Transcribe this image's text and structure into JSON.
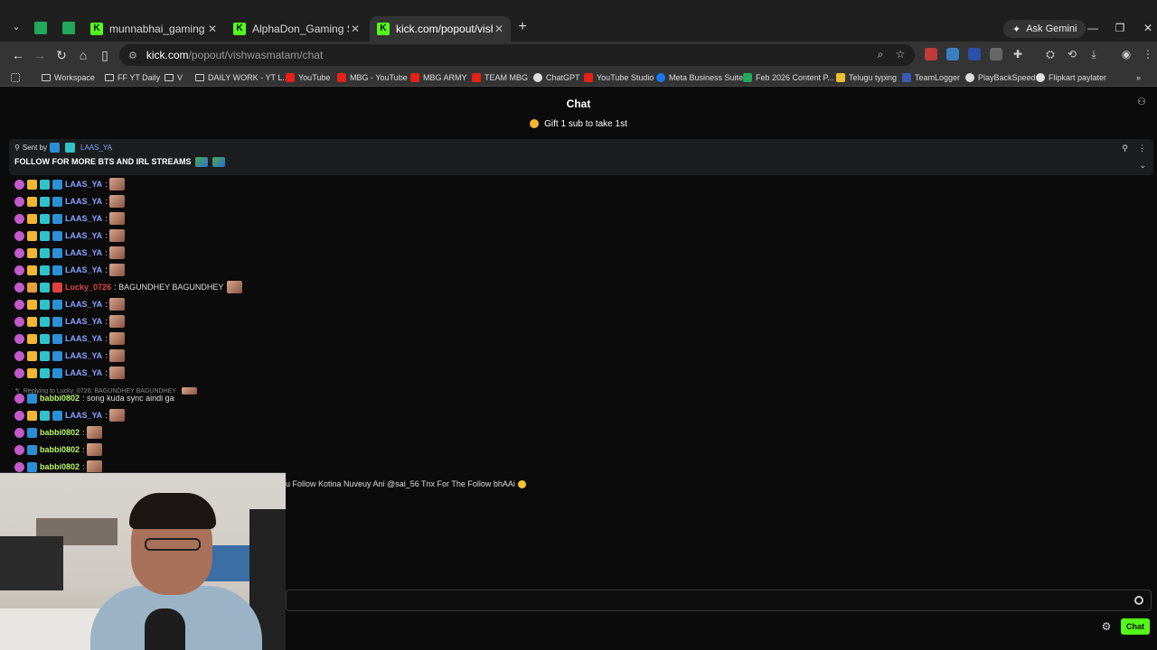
{
  "browser": {
    "tabs": [
      {
        "title": "munnabhai_gaming Stream - Ki"
      },
      {
        "title": "AlphaDon_Gaming Stream - Kic"
      },
      {
        "title": "kick.com/popout/vishwasmatam"
      }
    ],
    "gemini_label": "Ask Gemini",
    "url_domain": "kick.com",
    "url_path": "/popout/vishwasmatam/chat",
    "bookmarks": [
      "Workspace",
      "FF YT Daily",
      "V",
      "DAILY WORK - YT L...",
      "YouTube",
      "MBG - YouTube",
      "MBG ARMY",
      "TEAM MBG",
      "ChatGPT",
      "YouTube Studio",
      "Meta Business Suite",
      "Feb 2026 Content P...",
      "Telugu typing",
      "TeamLogger",
      "PlayBackSpeed",
      "Flipkart paylater"
    ]
  },
  "chat": {
    "header": "Chat",
    "gift_banner": "Gift 1 sub to take 1st",
    "pinned": {
      "sent_by_label": "Sent by",
      "sender": "LAAS_YA",
      "message": "FOLLOW FOR MORE BTS AND IRL STREAMS"
    },
    "messages": [
      {
        "user": "LAAS_YA",
        "text": ""
      },
      {
        "user": "LAAS_YA",
        "text": ""
      },
      {
        "user": "LAAS_YA",
        "text": ""
      },
      {
        "user": "LAAS_YA",
        "text": ""
      },
      {
        "user": "LAAS_YA",
        "text": ""
      },
      {
        "user": "LAAS_YA",
        "text": ""
      },
      {
        "user": "Lucky_0726",
        "text": "BAGUNDHEY BAGUNDHEY"
      },
      {
        "user": "LAAS_YA",
        "text": ""
      },
      {
        "user": "LAAS_YA",
        "text": ""
      },
      {
        "user": "LAAS_YA",
        "text": ""
      },
      {
        "user": "LAAS_YA",
        "text": ""
      },
      {
        "user": "LAAS_YA",
        "text": ""
      },
      {
        "user": "babbi0802",
        "text": "song kuda sync aindi ga"
      },
      {
        "user": "LAAS_YA",
        "text": ""
      },
      {
        "user": "babbi0802",
        "text": ""
      },
      {
        "user": "babbi0802",
        "text": ""
      },
      {
        "user": "babbi0802",
        "text": ""
      }
    ],
    "reply_context": "Replying to Lucky_0726: BAGUNDHEY BAGUNDHEY",
    "partial_message": "u Follow Kotina Nuveuy Ani @sai_56 Tnx For The Follow bhAAi",
    "input_placeholder": "",
    "send_label": "Chat"
  },
  "colors": {
    "kick_green": "#53fc18",
    "laas_ya": "#87a3ff",
    "lucky": "#e04040",
    "babbi": "#b8f36b"
  }
}
